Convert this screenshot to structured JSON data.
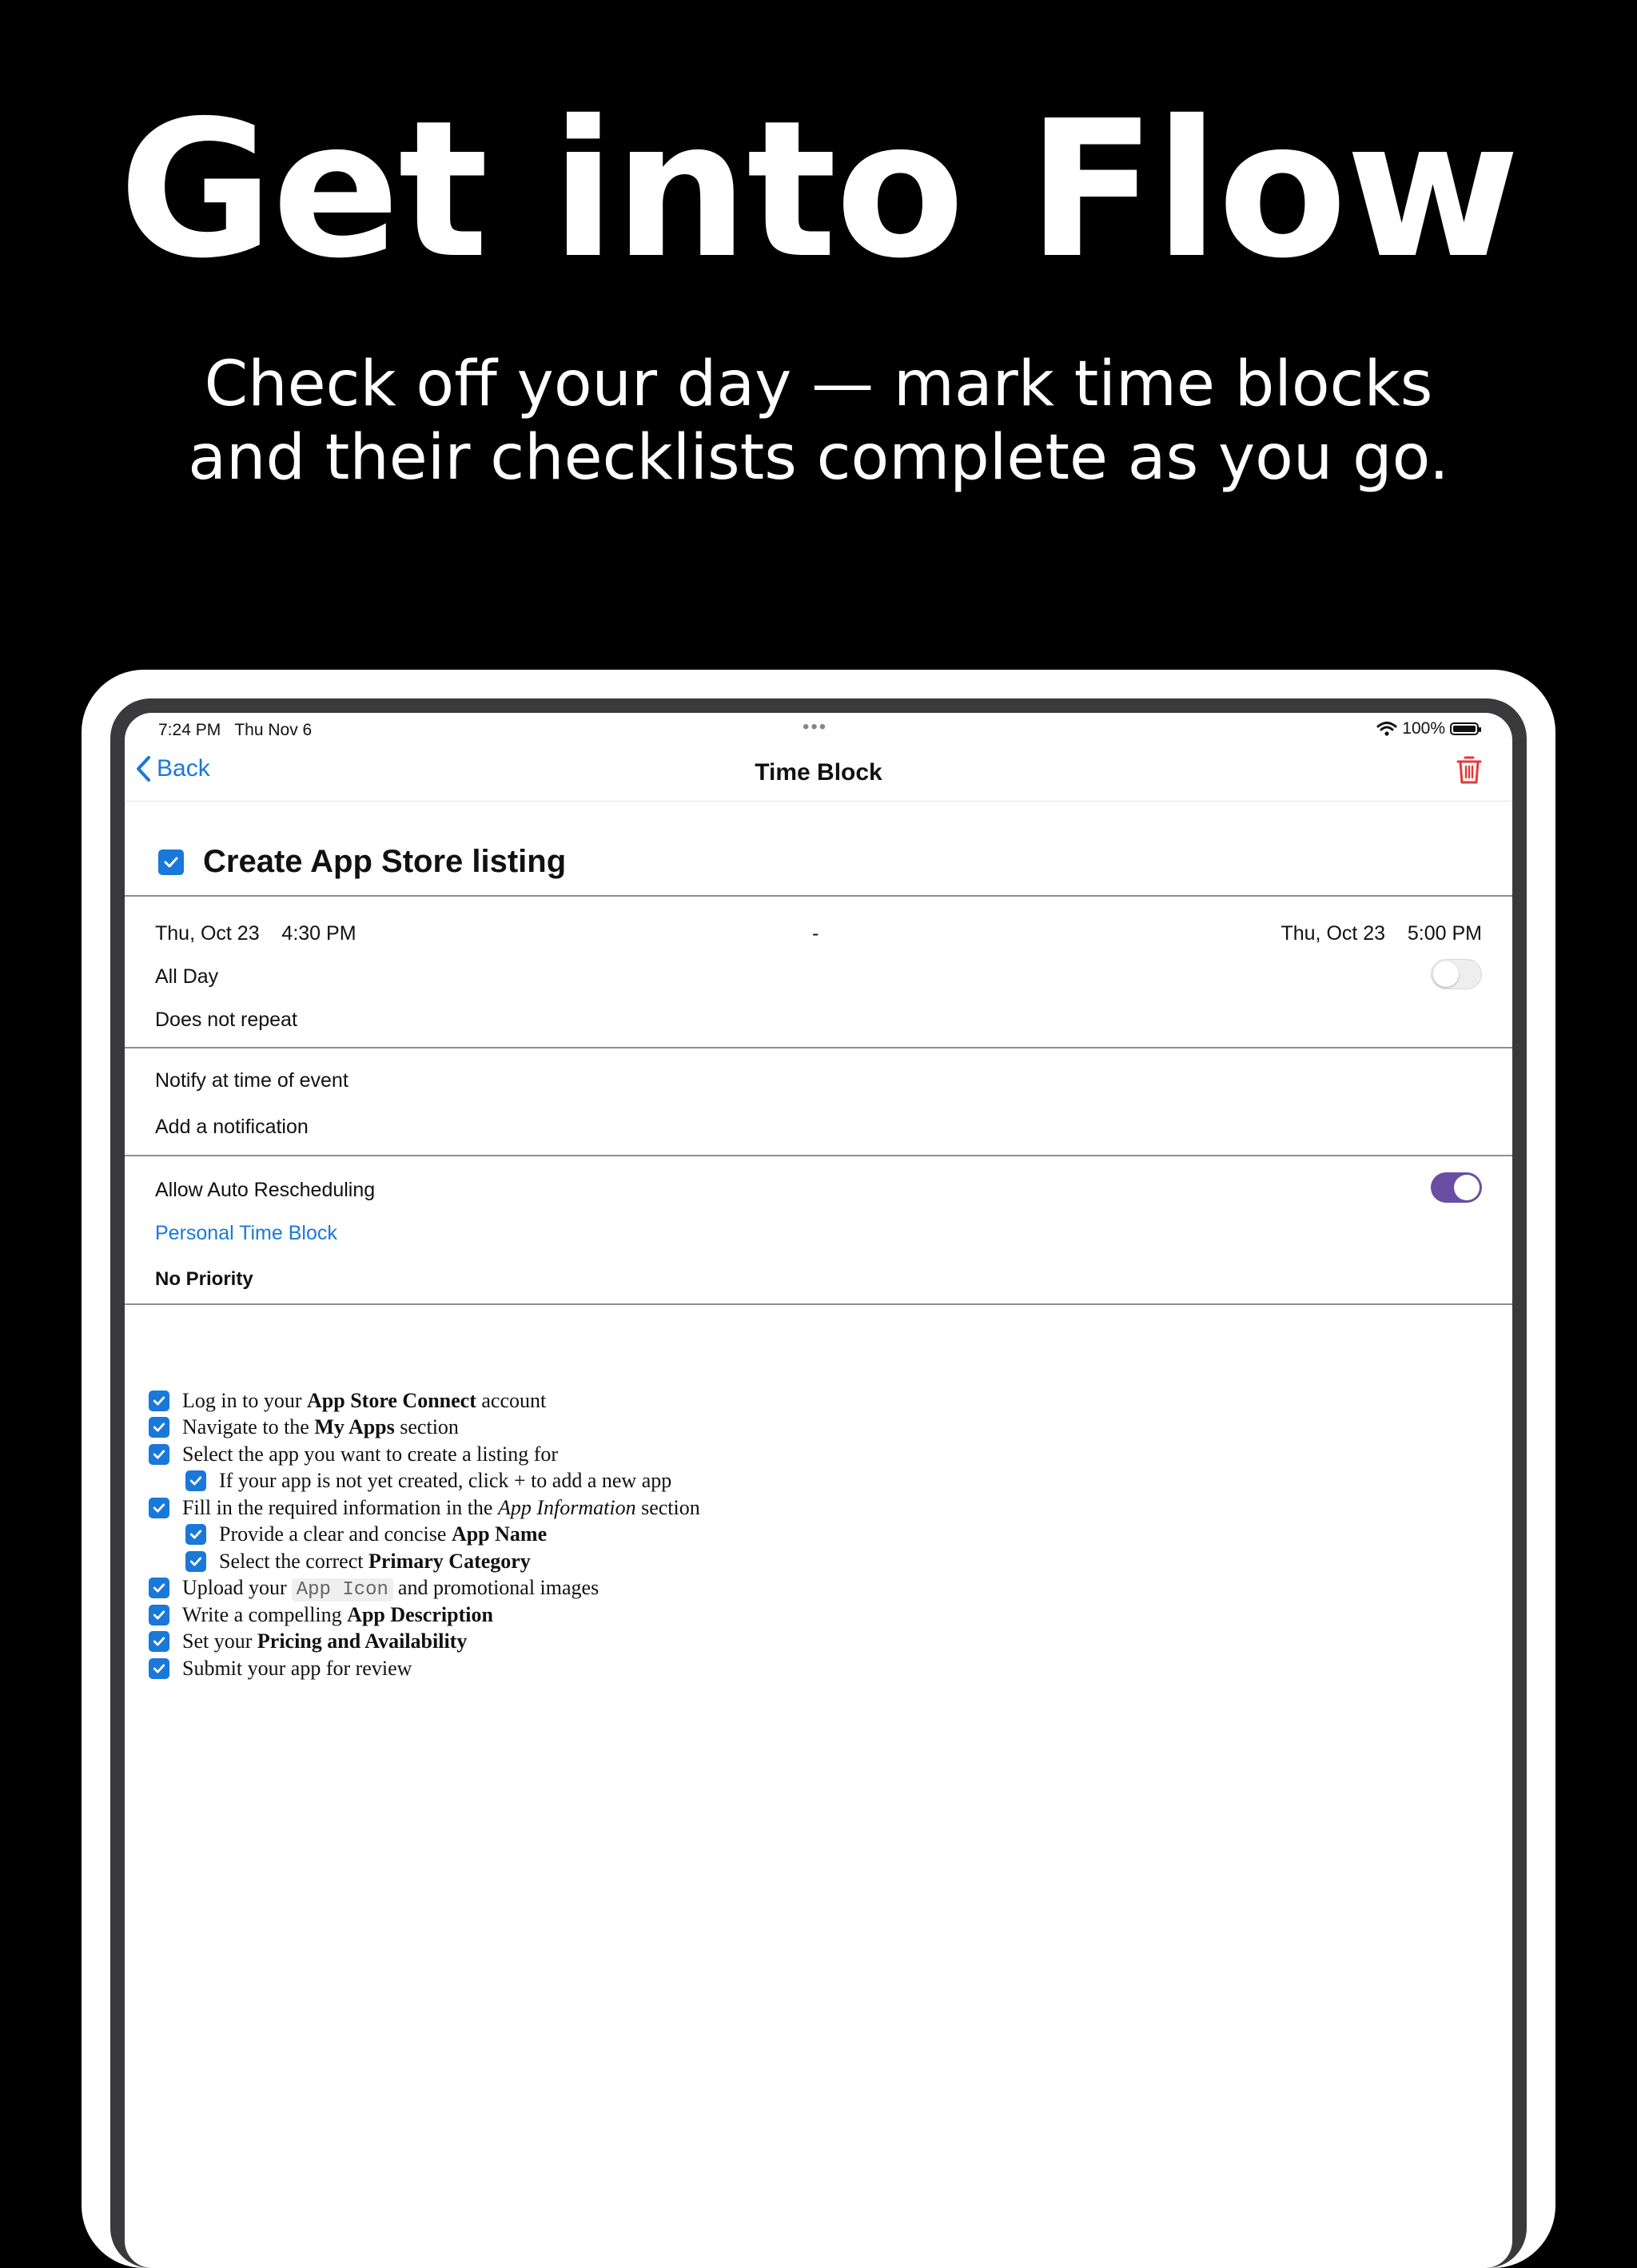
{
  "headline": "Get into Flow",
  "subhead": {
    "line1": "Check off your day — mark time blocks",
    "line2": "and their checklists complete as you go."
  },
  "status_bar": {
    "time": "7:24 PM",
    "date": "Thu Nov 6",
    "battery": "100%"
  },
  "nav": {
    "back_label": "Back",
    "title": "Time Block"
  },
  "block": {
    "title": "Create App Store listing",
    "completed": true,
    "start_date": "Thu, Oct 23",
    "start_time": "4:30 PM",
    "separator": "-",
    "end_date": "Thu, Oct 23",
    "end_time": "5:00 PM",
    "all_day_label": "All Day",
    "all_day": false,
    "repeat": "Does not repeat",
    "notification": "Notify at time of event",
    "add_notification": "Add a notification",
    "auto_reschedule_label": "Allow Auto Rescheduling",
    "auto_reschedule": true,
    "category": "Personal Time Block",
    "priority": "No Priority"
  },
  "checklist": [
    {
      "indent": 0,
      "checked": true,
      "parts": [
        {
          "t": "Log in to your "
        },
        {
          "t": "App Store Connect",
          "s": "b"
        },
        {
          "t": " account"
        }
      ]
    },
    {
      "indent": 0,
      "checked": true,
      "parts": [
        {
          "t": "Navigate to the "
        },
        {
          "t": "My Apps",
          "s": "b"
        },
        {
          "t": " section"
        }
      ]
    },
    {
      "indent": 0,
      "checked": true,
      "parts": [
        {
          "t": "Select the app you want to create a listing for"
        }
      ]
    },
    {
      "indent": 1,
      "checked": true,
      "parts": [
        {
          "t": "If your app is not yet created, click + to add a new app"
        }
      ]
    },
    {
      "indent": 0,
      "checked": true,
      "parts": [
        {
          "t": "Fill in the required information in the "
        },
        {
          "t": "App Information",
          "s": "i"
        },
        {
          "t": " section"
        }
      ]
    },
    {
      "indent": 1,
      "checked": true,
      "parts": [
        {
          "t": "Provide a clear and concise "
        },
        {
          "t": "App Name",
          "s": "b"
        }
      ]
    },
    {
      "indent": 1,
      "checked": true,
      "parts": [
        {
          "t": "Select the correct "
        },
        {
          "t": "Primary Category",
          "s": "b"
        }
      ]
    },
    {
      "indent": 0,
      "checked": true,
      "parts": [
        {
          "t": "Upload your"
        },
        {
          "t": "App Icon",
          "s": "code"
        },
        {
          "t": "and promotional images"
        }
      ]
    },
    {
      "indent": 0,
      "checked": true,
      "parts": [
        {
          "t": "Write a compelling "
        },
        {
          "t": "App Description",
          "s": "b"
        }
      ]
    },
    {
      "indent": 0,
      "checked": true,
      "parts": [
        {
          "t": "Set your "
        },
        {
          "t": "Pricing and Availability",
          "s": "b"
        }
      ]
    },
    {
      "indent": 0,
      "checked": true,
      "parts": [
        {
          "t": "Submit your app for review"
        }
      ]
    }
  ],
  "colors": {
    "accent_blue": "#1a78d8",
    "toggle_on": "#6a4ea3",
    "trash_red": "#e53935"
  },
  "icons": {
    "back": "chevron-left-icon",
    "trash": "trash-icon",
    "wifi": "wifi-icon",
    "battery": "battery-icon",
    "checkbox": "checkbox-checked-icon"
  }
}
